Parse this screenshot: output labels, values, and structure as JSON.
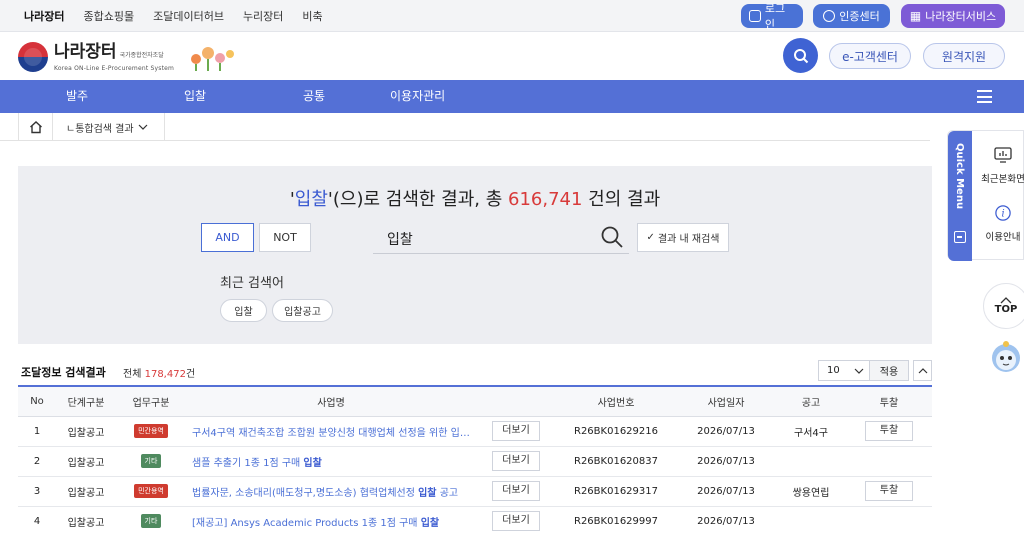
{
  "util_bar": {
    "links": [
      "나라장터",
      "종합쇼핑몰",
      "조달데이터허브",
      "누리장터",
      "비축"
    ],
    "login_label": "로그인",
    "cert_label": "인증센터",
    "nara_service_label": "나라장터서비스"
  },
  "header": {
    "logo_title": "나라장터",
    "logo_tagline": "국가종합전자조달",
    "logo_subtitle": "Korea ON-Line E-Procurement System",
    "ecenter_label": "e-고객센터",
    "remote_label": "원격지원"
  },
  "mainnav": {
    "items": [
      "발주",
      "입찰",
      "공통",
      "이용자관리"
    ]
  },
  "breadcrumb": {
    "current": "ㄴ통합검색 결과"
  },
  "search": {
    "title_prefix": "'",
    "keyword": "입찰",
    "title_mid": "'(으)로 검색한 결과, 총 ",
    "count": "616,741",
    "title_suffix": " 건의 결과",
    "and_label": "AND",
    "not_label": "NOT",
    "query": "입찰",
    "refine_label": "결과 내 재검색",
    "recent_label": "최근 검색어",
    "recent_terms": [
      "입찰",
      "입찰공고"
    ]
  },
  "section": {
    "title": "조달정보 검색결과",
    "total_prefix": "전체 ",
    "total_count": "178,472",
    "total_suffix": "건",
    "page_size": "10",
    "apply_label": "적용"
  },
  "table": {
    "headers": [
      "No",
      "단계구분",
      "업무구분",
      "사업명",
      "",
      "사업번호",
      "사업일자",
      "공고",
      "투찰"
    ],
    "rows": [
      {
        "no": "1",
        "stage": "입찰공고",
        "biz_type": "민간용역",
        "biz_color": "red",
        "name": "구서4구역 재건축조합 조합원 분양신청 대행업체 선정을 위한 입…",
        "name_bold": "",
        "more": "더보기",
        "biz_no": "R26BK01629216",
        "date": "2026/07/13",
        "notice": "구서4구",
        "bid": "투찰"
      },
      {
        "no": "2",
        "stage": "입찰공고",
        "biz_type": "기타",
        "biz_color": "green",
        "name": "샘플 추출기 1종 1점 구매 ",
        "name_bold": "입찰",
        "more": "더보기",
        "biz_no": "R26BK01620837",
        "date": "2026/07/13",
        "notice": "",
        "bid": ""
      },
      {
        "no": "3",
        "stage": "입찰공고",
        "biz_type": "민간용역",
        "biz_color": "red",
        "name": "법률자문, 소송대리(매도청구,명도소송) 협력업체선정 ",
        "name_bold": "입찰",
        "name_tail": " 공고",
        "more": "더보기",
        "biz_no": "R26BK01629317",
        "date": "2026/07/13",
        "notice": "쌍용연립",
        "bid": "투찰"
      },
      {
        "no": "4",
        "stage": "입찰공고",
        "biz_type": "기타",
        "biz_color": "green",
        "name": "[재공고] Ansys Academic Products 1종 1점 구매 ",
        "name_bold": "입찰",
        "more": "더보기",
        "biz_no": "R26BK01629997",
        "date": "2026/07/13",
        "notice": "",
        "bid": ""
      }
    ]
  },
  "quick_menu": {
    "title": "Quick Menu",
    "items": [
      "최근본화면",
      "이용안내"
    ],
    "top_label": "TOP"
  },
  "colors": {
    "brand_blue": "#5470d6",
    "accent_red": "#d83a3a",
    "purple": "#7e5bd6"
  }
}
